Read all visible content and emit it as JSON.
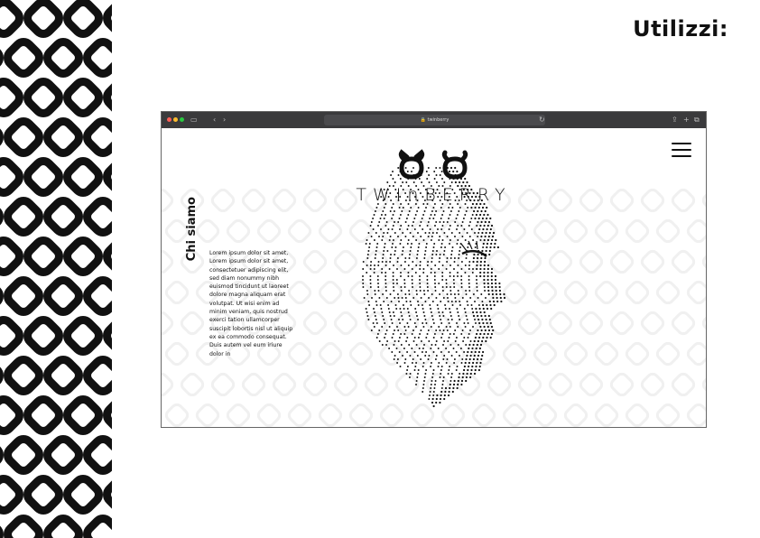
{
  "page": {
    "heading": "Utilizzi:"
  },
  "browser": {
    "url": "twinberry",
    "traffic_lights": [
      "#ff5f57",
      "#febc2e",
      "#28c840"
    ],
    "chrome_color": "#3a3a3c"
  },
  "website": {
    "brand_name": "TWInBERRY",
    "section_title": "Chi siamo",
    "section_text": "Lorem ipsum dolor sit amet, Lorem ipsum dolor sit amet, consectetuer adipiscing elit, sed diam nonummy nibh euismod tincidunt ut laoreet dolore magna aliquam erat volutpat. Ut wisi enim ad minim veniam, quis nostrud exerci tation ullamcorper suscipit lobortis nisl ut aliquip ex ea commodo consequat. Duis autem vel eum iriure dolor in",
    "menu_icon": "hamburger-menu-icon",
    "hero_image": "dotted-face-profile"
  }
}
